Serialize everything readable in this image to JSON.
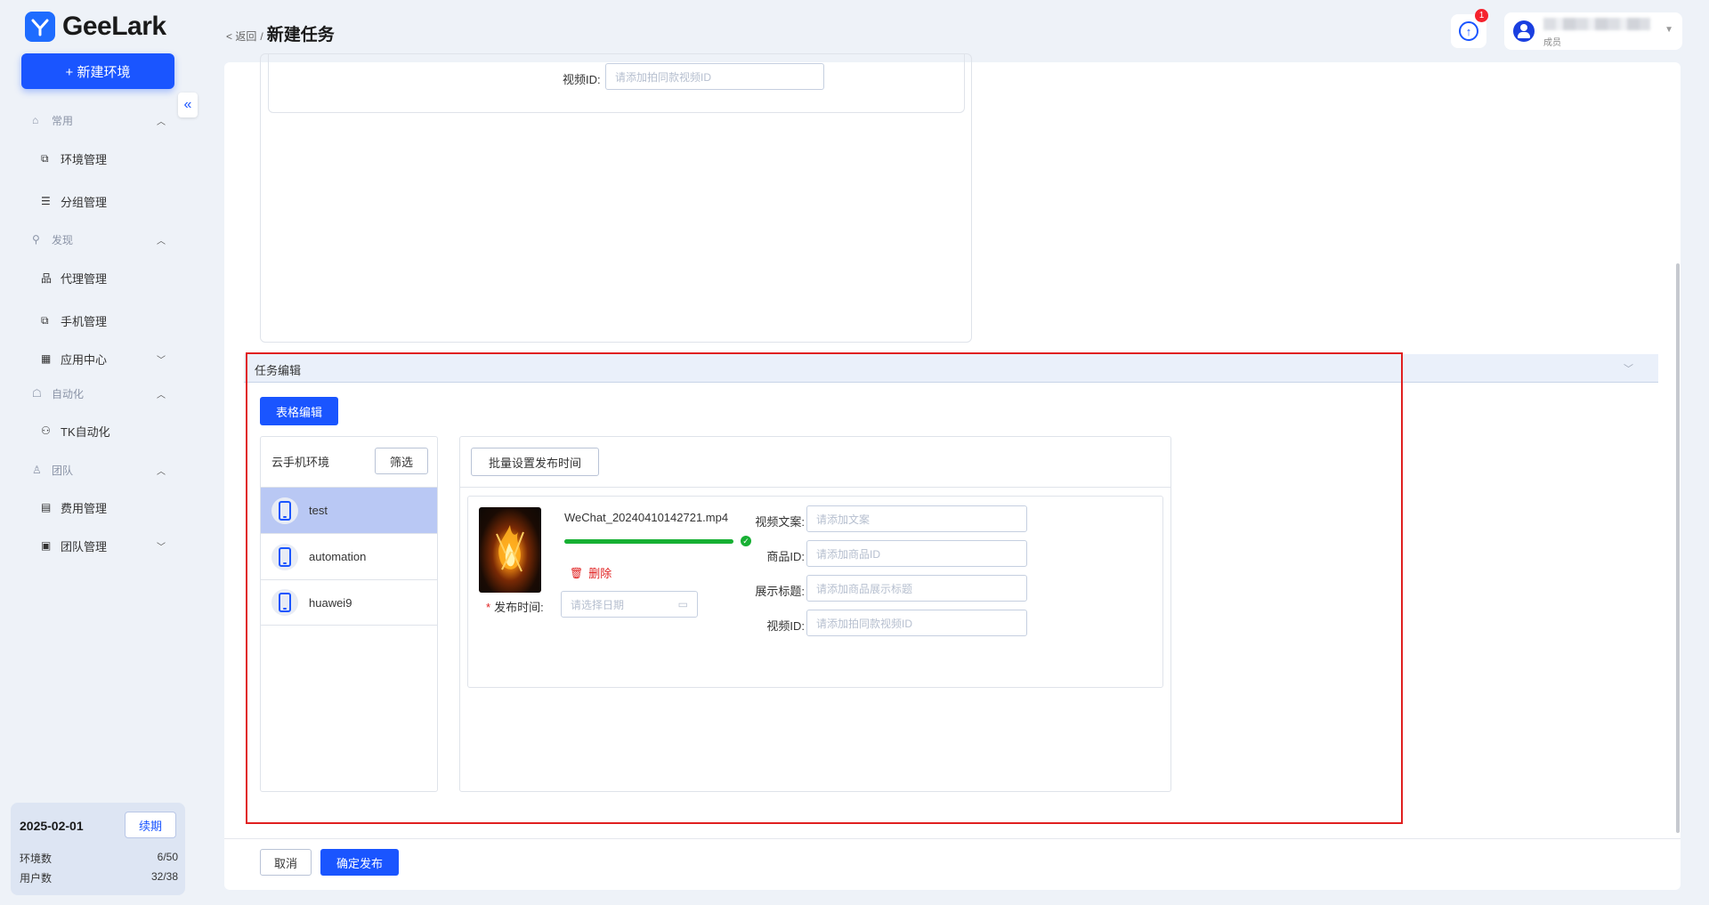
{
  "app": {
    "brand": "GeeLark",
    "accent": "#1a55ff"
  },
  "sidebar": {
    "new_env_label": "+ 新建环境",
    "collapse_icon": "«",
    "groups": [
      {
        "label": "常用"
      },
      {
        "label": "发现"
      },
      {
        "label": "自动化"
      },
      {
        "label": "团队"
      }
    ],
    "items": [
      {
        "label": "环境管理"
      },
      {
        "label": "分组管理"
      },
      {
        "label": "代理管理"
      },
      {
        "label": "手机管理"
      },
      {
        "label": "应用中心"
      },
      {
        "label": "TK自动化"
      },
      {
        "label": "费用管理"
      },
      {
        "label": "团队管理"
      }
    ],
    "plan": {
      "date": "2025-02-01",
      "renew_label": "续期",
      "env_count_label": "环境数",
      "env_count_value": "6/50",
      "user_count_label": "用户数",
      "user_count_value": "32/38"
    }
  },
  "header": {
    "back_label": "< 返回",
    "separator": "/",
    "title": "新建任务",
    "notification_count": "1",
    "user_role": "成员"
  },
  "upper_form": {
    "video_id_label": "视频ID:",
    "video_id_placeholder": "请添加拍同款视频ID"
  },
  "task_section": {
    "title": "任务编辑",
    "table_edit_label": "表格编辑",
    "env_list_title": "云手机环境",
    "filter_label": "筛选",
    "environments": [
      {
        "name": "test",
        "active": true
      },
      {
        "name": "automation",
        "active": false
      },
      {
        "name": "huawei9",
        "active": false
      }
    ],
    "batch_time_label": "批量设置发布时间",
    "video": {
      "file_name": "WeChat_20240410142721.mp4",
      "upload_progress": 1.0,
      "delete_label": "删除",
      "publish_time_label": "发布时间:",
      "publish_time_placeholder": "请选择日期",
      "fields": [
        {
          "label": "视频文案:",
          "placeholder": "请添加文案"
        },
        {
          "label": "商品ID:",
          "placeholder": "请添加商品ID"
        },
        {
          "label": "展示标题:",
          "placeholder": "请添加商品展示标题"
        },
        {
          "label": "视频ID:",
          "placeholder": "请添加拍同款视频ID"
        }
      ]
    }
  },
  "footer": {
    "cancel_label": "取消",
    "confirm_label": "确定发布"
  }
}
